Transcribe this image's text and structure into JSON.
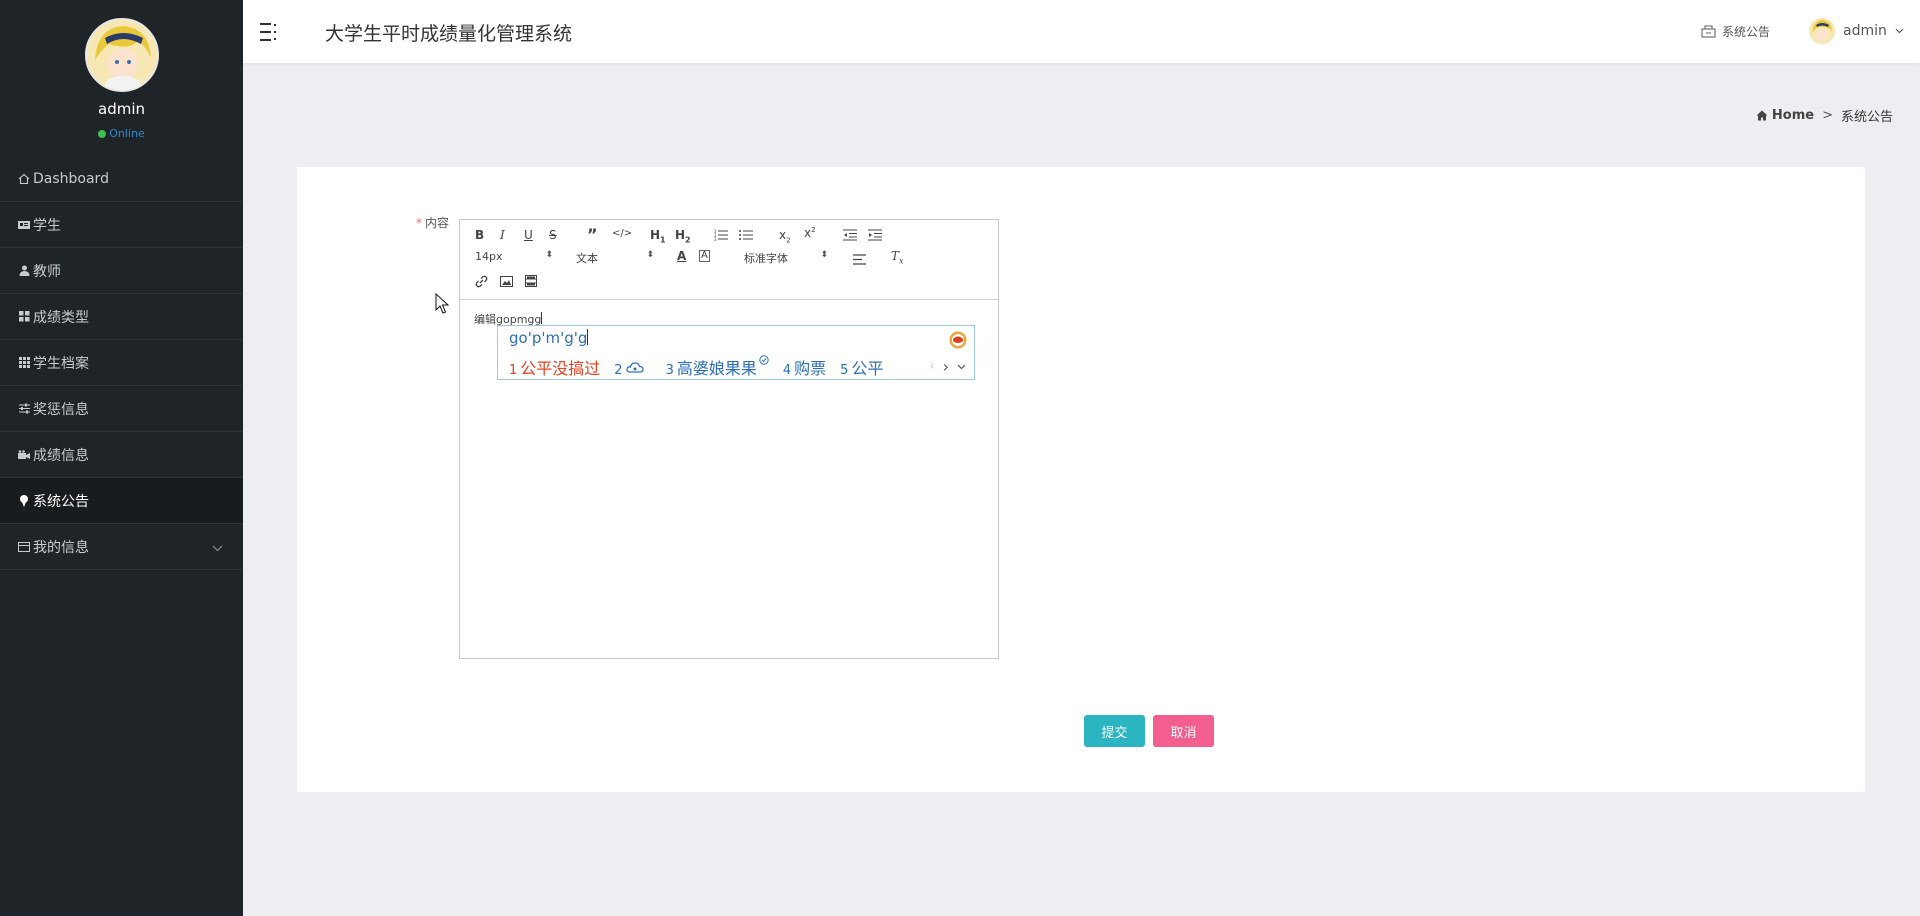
{
  "sidebar": {
    "username": "admin",
    "status": "Online",
    "items": [
      {
        "label": "Dashboard",
        "icon": "home-icon"
      },
      {
        "label": "学生",
        "icon": "id-card-icon"
      },
      {
        "label": "教师",
        "icon": "user-icon"
      },
      {
        "label": "成绩类型",
        "icon": "grid-icon"
      },
      {
        "label": "学生档案",
        "icon": "table-icon"
      },
      {
        "label": "奖惩信息",
        "icon": "sliders-icon"
      },
      {
        "label": "成绩信息",
        "icon": "camera-icon"
      },
      {
        "label": "系统公告",
        "icon": "pin-icon",
        "active": true
      },
      {
        "label": "我的信息",
        "icon": "card-icon",
        "expandable": true
      }
    ]
  },
  "header": {
    "title": "大学生平时成绩量化管理系统",
    "notice_label": "系统公告",
    "user_label": "admin"
  },
  "breadcrumb": {
    "home": "Home",
    "separator": ">",
    "current": "系统公告"
  },
  "form": {
    "required_mark": "*",
    "content_label": "内容",
    "editor": {
      "font_size": "14px",
      "paragraph_format": "文本",
      "font_family": "标准字体",
      "content": "编辑gopmgg"
    },
    "submit_label": "提交",
    "cancel_label": "取消"
  },
  "ime": {
    "composition": "go'p'm'g'g",
    "candidates": [
      {
        "num": "1",
        "text": "公平没搞过"
      },
      {
        "num": "2",
        "text": ""
      },
      {
        "num": "3",
        "text": "高婆娘果果"
      },
      {
        "num": "4",
        "text": "购票"
      },
      {
        "num": "5",
        "text": "公平"
      }
    ]
  },
  "colors": {
    "sidebar_bg": "#1e2427",
    "submit": "#2bb5c2",
    "cancel": "#f35e8f",
    "online": "#3fbf4d"
  }
}
